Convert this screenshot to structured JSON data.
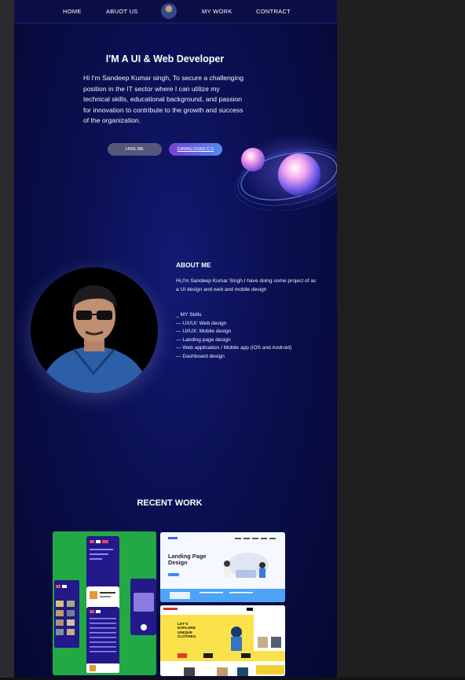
{
  "nav": {
    "items": [
      "HOME",
      "ABUOT US",
      "MY WORK",
      "CONTRACT"
    ],
    "avatar_icon": "profile-avatar-icon"
  },
  "hero": {
    "title": "I'M A  UI & Web Developer",
    "text": "Hi  I'm Sandeep Kumar singh,  To secure a challenging position in the IT sector where I can utilize my technical skills, educational background, and passion for innovation to contribute to the growth and success of the organization.",
    "hire_label": "HIRE ME",
    "cv_label": "DAWNLOOAD C.V"
  },
  "about": {
    "title": "ABOUT ME",
    "intro": "Hi,I'm Sandeep Kumar Singh.I have doing some project of  as a UI design and  web and mobile design",
    "skills": [
      "_ MY Skills",
      "— UX/UI: Web design",
      "— UI/UX: Mobile design",
      "— Landing page design",
      "— Web application / Mobile app (iOS and Android)",
      "— Dashboard design"
    ]
  },
  "work": {
    "title": "RECENT WORK",
    "landing_card_heading": "Landing Page Design",
    "fashion_card_heading": "LET'S EXPLORE UNIQUE CLOTHES."
  },
  "colors": {
    "background": "#0a0f4f",
    "nav": "#0b0f45",
    "hire_button": "#55577a",
    "cv_gradient_start": "#7a3fd6",
    "cv_gradient_end": "#4f8df0",
    "mobile_card": "#22a844",
    "fashion_card": "#f9dc3d"
  }
}
